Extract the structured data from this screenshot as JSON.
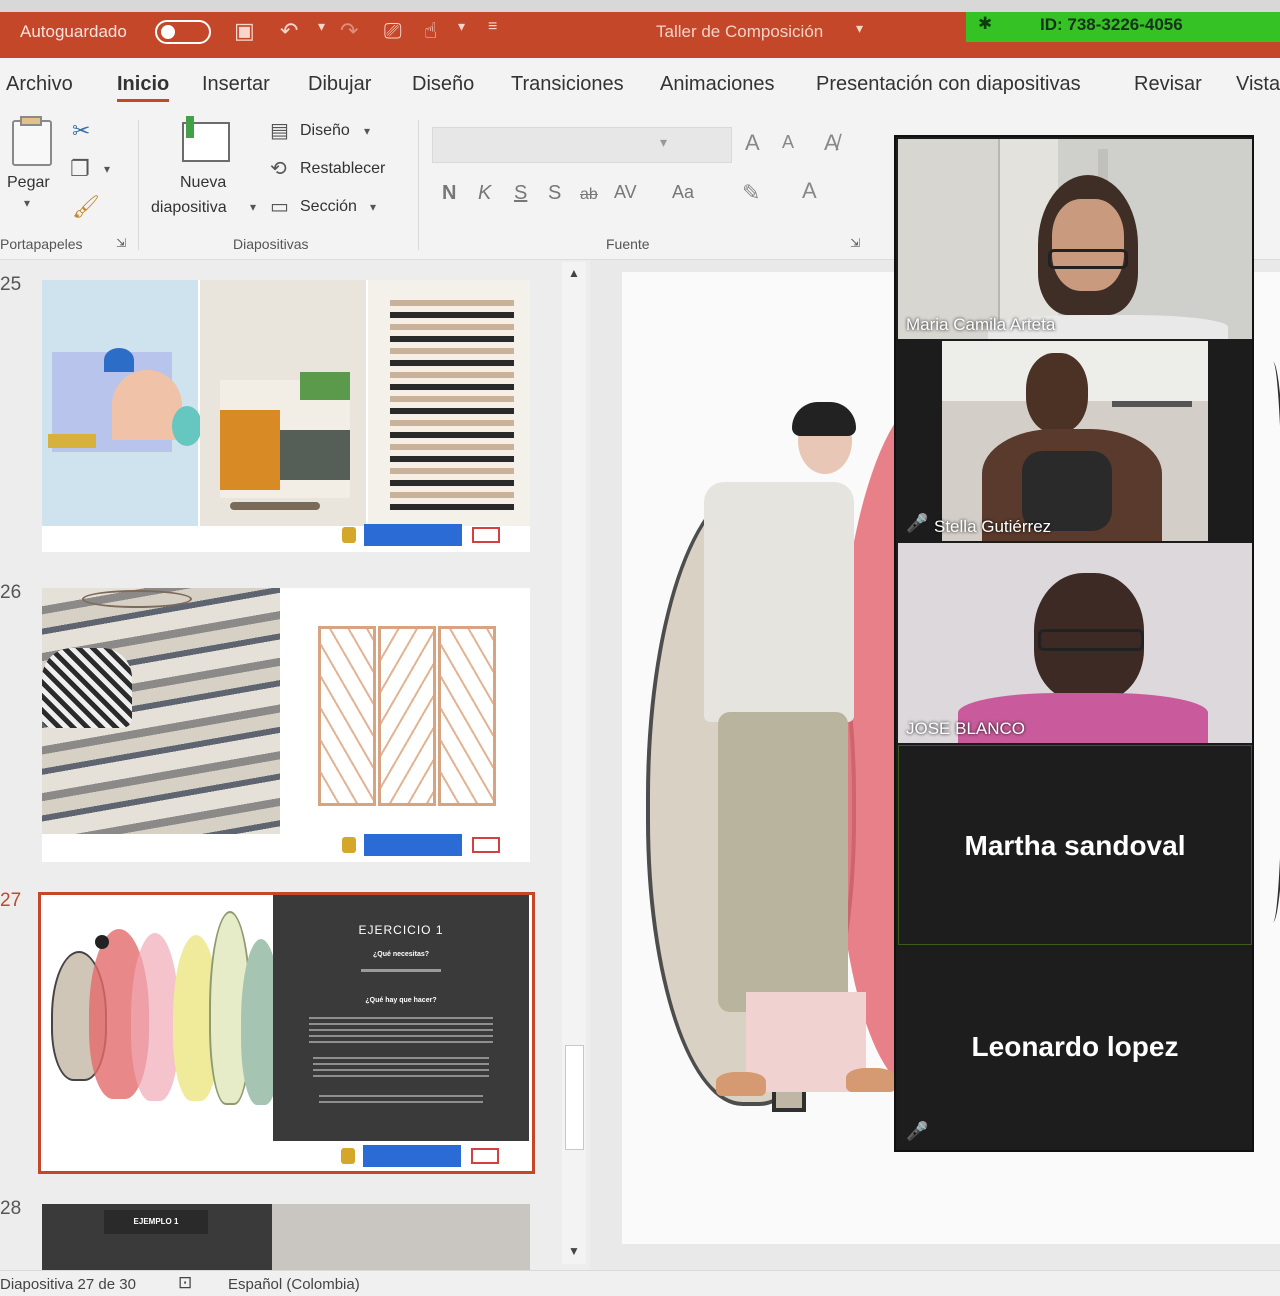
{
  "titlebar": {
    "autosave_label": "Autoguardado",
    "doc_title": "Taller de Composición",
    "meeting_id": "ID: 738-3226-4056",
    "accent_color": "#c4472a",
    "meeting_bar_color": "#35c224"
  },
  "menu": {
    "tabs": [
      "Archivo",
      "Inicio",
      "Insertar",
      "Dibujar",
      "Diseño",
      "Transiciones",
      "Animaciones",
      "Presentación con diapositivas",
      "Revisar",
      "Vista"
    ],
    "active_tab": "Inicio"
  },
  "ribbon": {
    "paste_label": "Pegar",
    "new_slide_line1": "Nueva",
    "new_slide_line2": "diapositiva",
    "layout_label": "Diseño",
    "reset_label": "Restablecer",
    "section_label": "Sección",
    "groups": {
      "clipboard": "Portapapeles",
      "slides": "Diapositivas",
      "font": "Fuente"
    },
    "format_buttons": [
      "N",
      "K",
      "S",
      "S",
      "ab",
      "AV",
      "Aa"
    ]
  },
  "slides": {
    "numbers": [
      "25",
      "26",
      "27",
      "28"
    ],
    "selected": "27",
    "exercise": {
      "title": "EJERCICIO 1",
      "q1": "¿Qué necesitas?",
      "q2": "¿Qué hay que hacer?"
    },
    "slide28_label": "EJEMPLO 1"
  },
  "participants": [
    {
      "name": "Maria Camila Arteta",
      "video": true,
      "muted": false
    },
    {
      "name": "Stella Gutiérrez",
      "video": true,
      "muted": true
    },
    {
      "name": "JOSE BLANCO",
      "video": true,
      "muted": false
    },
    {
      "name": "Martha sandoval",
      "video": false,
      "muted": false
    },
    {
      "name": "Leonardo lopez",
      "video": false,
      "muted": true
    }
  ],
  "statusbar": {
    "slide_counter": "Diapositiva 27 de 30",
    "language": "Español (Colombia)"
  }
}
